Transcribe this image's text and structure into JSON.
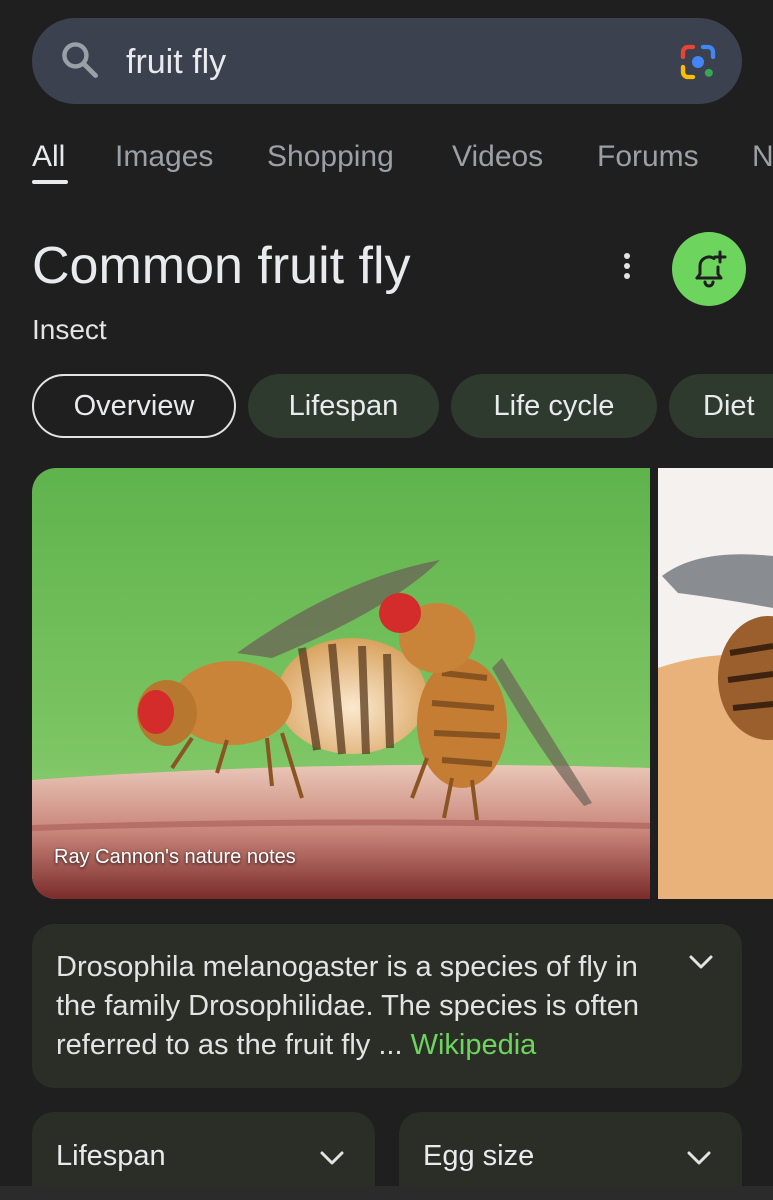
{
  "search": {
    "query": "fruit fly",
    "icon": "search-icon",
    "lens_icon": "google-lens-icon"
  },
  "tabs": [
    {
      "label": "All",
      "active": true
    },
    {
      "label": "Images"
    },
    {
      "label": "Shopping"
    },
    {
      "label": "Videos"
    },
    {
      "label": "Forums"
    },
    {
      "label": "N"
    }
  ],
  "entity": {
    "title": "Common fruit fly",
    "subtitle": "Insect",
    "more_icon": "more-vert-icon",
    "follow_icon": "bell-plus-icon"
  },
  "chips": [
    {
      "label": "Overview",
      "active": true
    },
    {
      "label": "Lifespan"
    },
    {
      "label": "Life cycle"
    },
    {
      "label": "Diet"
    }
  ],
  "image": {
    "caption": "Ray Cannon's nature notes"
  },
  "description": {
    "text": "Drosophila melanogaster is a species of fly in the family Drosophilidae. The species is often referred to as the fruit fly ... ",
    "source": "Wikipedia"
  },
  "facts": [
    {
      "label": "Lifespan"
    },
    {
      "label": "Egg size"
    }
  ],
  "colors": {
    "accent": "#6dd55d",
    "background": "#1f1f1f",
    "search_bar": "#3c4150",
    "card": "#2a2e27"
  }
}
